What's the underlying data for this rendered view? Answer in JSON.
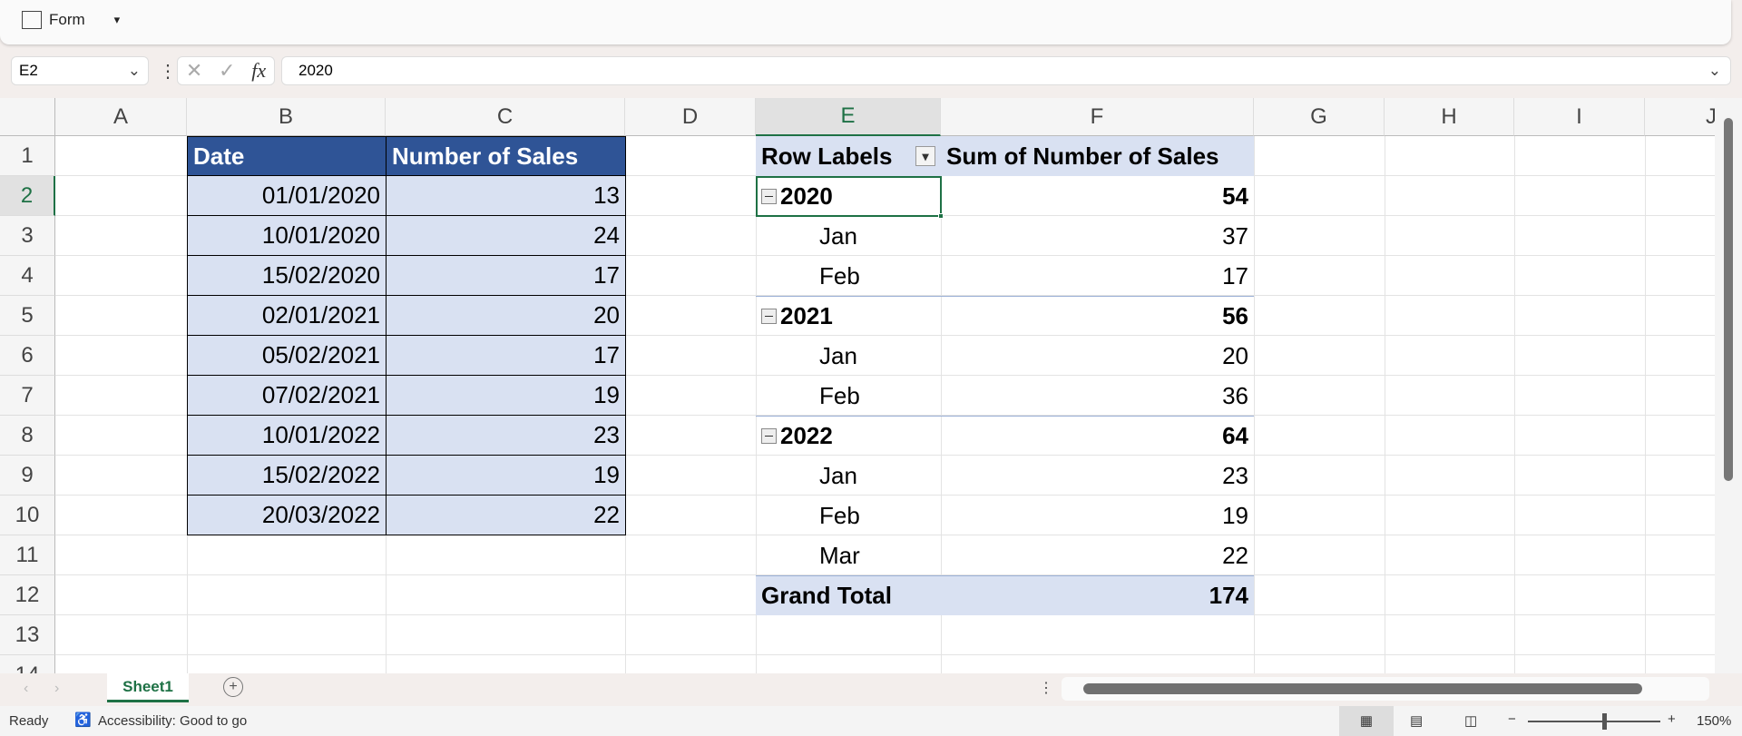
{
  "ribbon": {
    "form_label": "Form"
  },
  "formula_bar": {
    "name_box": "E2",
    "formula": "2020"
  },
  "columns": [
    "A",
    "B",
    "C",
    "D",
    "E",
    "F",
    "G",
    "H",
    "I",
    "J"
  ],
  "rows": [
    "1",
    "2",
    "3",
    "4",
    "5",
    "6",
    "7",
    "8",
    "9",
    "10",
    "11",
    "12",
    "13",
    "14"
  ],
  "table": {
    "headers": [
      "Date",
      "Number of Sales"
    ],
    "rows": [
      [
        "01/01/2020",
        "13"
      ],
      [
        "10/01/2020",
        "24"
      ],
      [
        "15/02/2020",
        "17"
      ],
      [
        "02/01/2021",
        "20"
      ],
      [
        "05/02/2021",
        "17"
      ],
      [
        "07/02/2021",
        "19"
      ],
      [
        "10/01/2022",
        "23"
      ],
      [
        "15/02/2022",
        "19"
      ],
      [
        "20/03/2022",
        "22"
      ]
    ]
  },
  "pivot": {
    "headers": [
      "Row Labels",
      "Sum of Number of Sales"
    ],
    "rows": [
      {
        "label": "2020",
        "value": "54",
        "year": true
      },
      {
        "label": "Jan",
        "value": "37"
      },
      {
        "label": "Feb",
        "value": "17"
      },
      {
        "label": "2021",
        "value": "56",
        "year": true
      },
      {
        "label": "Jan",
        "value": "20"
      },
      {
        "label": "Feb",
        "value": "36"
      },
      {
        "label": "2022",
        "value": "64",
        "year": true
      },
      {
        "label": "Jan",
        "value": "23"
      },
      {
        "label": "Feb",
        "value": "19"
      },
      {
        "label": "Mar",
        "value": "22"
      }
    ],
    "grand_total_label": "Grand Total",
    "grand_total": "174"
  },
  "sheets": [
    {
      "name": "Sheet1",
      "active": true
    }
  ],
  "status": {
    "ready": "Ready",
    "accessibility": "Accessibility: Good to go",
    "zoom": "150%"
  },
  "colors": {
    "header": "#2f5496",
    "band": "#d9e1f2",
    "accent": "#1e7145"
  }
}
